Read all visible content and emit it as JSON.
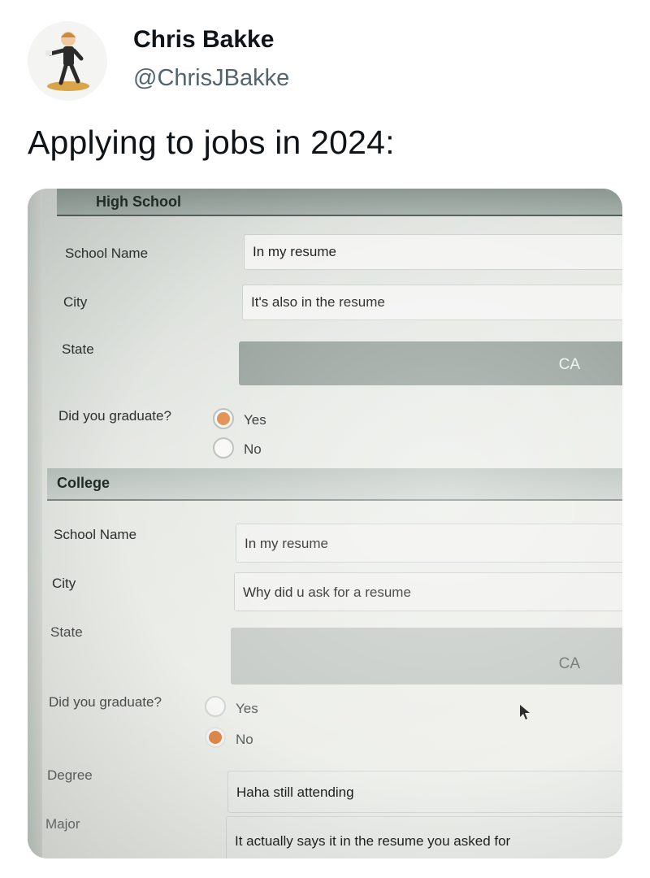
{
  "tweet": {
    "author_name": "Chris Bakke",
    "author_handle": "@ChrisJBakke",
    "text": "Applying to jobs in 2024:"
  },
  "form": {
    "high_school": {
      "header": "High School",
      "school_name_label": "School Name",
      "school_name_value": "In my resume",
      "city_label": "City",
      "city_value": "It's also in the resume",
      "state_label": "State",
      "state_value": "CA",
      "graduate_label": "Did you graduate?",
      "option_yes": "Yes",
      "option_no": "No",
      "selected": "Yes"
    },
    "college": {
      "header": "College",
      "school_name_label": "School Name",
      "school_name_value": "In my resume",
      "city_label": "City",
      "city_value": "Why did u ask for a resume",
      "state_label": "State",
      "state_value": "CA",
      "graduate_label": "Did you graduate?",
      "option_yes": "Yes",
      "option_no": "No",
      "selected": "No",
      "degree_label": "Degree",
      "degree_value": "Haha still attending",
      "major_label": "Major",
      "major_value": "It actually says it in the resume you asked for"
    }
  },
  "colors": {
    "radio_selected": "#e0894a",
    "select_bg": "#97a19b",
    "handle": "#536471"
  }
}
